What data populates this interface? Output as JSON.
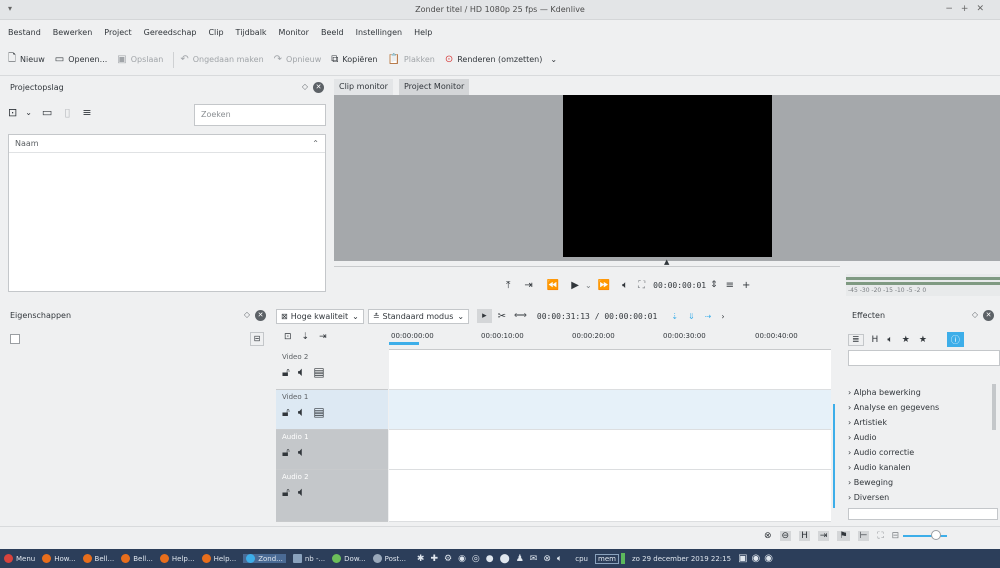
{
  "window": {
    "title": "Zonder titel / HD 1080p 25 fps — Kdenlive"
  },
  "menubar": [
    "Bestand",
    "Bewerken",
    "Project",
    "Gereedschap",
    "Clip",
    "Tijdbalk",
    "Monitor",
    "Beeld",
    "Instellingen",
    "Help"
  ],
  "toolbar": {
    "new": "Nieuw",
    "open": "Openen...",
    "save": "Opslaan",
    "undo": "Ongedaan maken",
    "redo": "Opnieuw",
    "copy": "Kopiëren",
    "paste": "Plakken",
    "render": "Renderen (omzetten)"
  },
  "project_bin": {
    "title": "Projectopslag",
    "search_placeholder": "Zoeken",
    "column_name": "Naam"
  },
  "monitor": {
    "tabs": [
      "Clip monitor",
      "Project Monitor"
    ],
    "active_tab": "Project Monitor",
    "timecode": "00:00:00:01"
  },
  "audio_meter": {
    "labels": "-45 -30 -20 -15 -10 -5 -2 0"
  },
  "properties": {
    "title": "Eigenschappen"
  },
  "timeline": {
    "quality": "Hoge kwaliteit",
    "mode": "Standaard modus",
    "position": "00:00:31:13 / 00:00:00:01",
    "ruler": [
      "00:00:00:00",
      "00:00:10:00",
      "00:00:20:00",
      "00:00:30:00",
      "00:00:40:00"
    ],
    "tracks": [
      {
        "name": "Video 2",
        "type": "video"
      },
      {
        "name": "Video 1",
        "type": "video"
      },
      {
        "name": "Audio 1",
        "type": "audio"
      },
      {
        "name": "Audio 2",
        "type": "audio"
      }
    ]
  },
  "effects": {
    "title": "Effecten",
    "categories": [
      "Alpha bewerking",
      "Analyse en gegevens",
      "Artistiek",
      "Audio",
      "Audio correctie",
      "Audio kanalen",
      "Beweging",
      "Diversen"
    ]
  },
  "taskbar": {
    "menu": "Menu",
    "tasks": [
      "How...",
      "Bell...",
      "Bell...",
      "Help...",
      "Help...",
      "Zond...",
      "nb -...",
      "Dow...",
      "Post..."
    ],
    "cpu": "cpu",
    "mem": "mem",
    "clock": "zo 29 december 2019 22:15"
  },
  "colors": {
    "accent": "#3daee9",
    "bg": "#eff0f1",
    "taskbar": "#2c3e5a",
    "monitor_bg": "#a5a8ab"
  }
}
